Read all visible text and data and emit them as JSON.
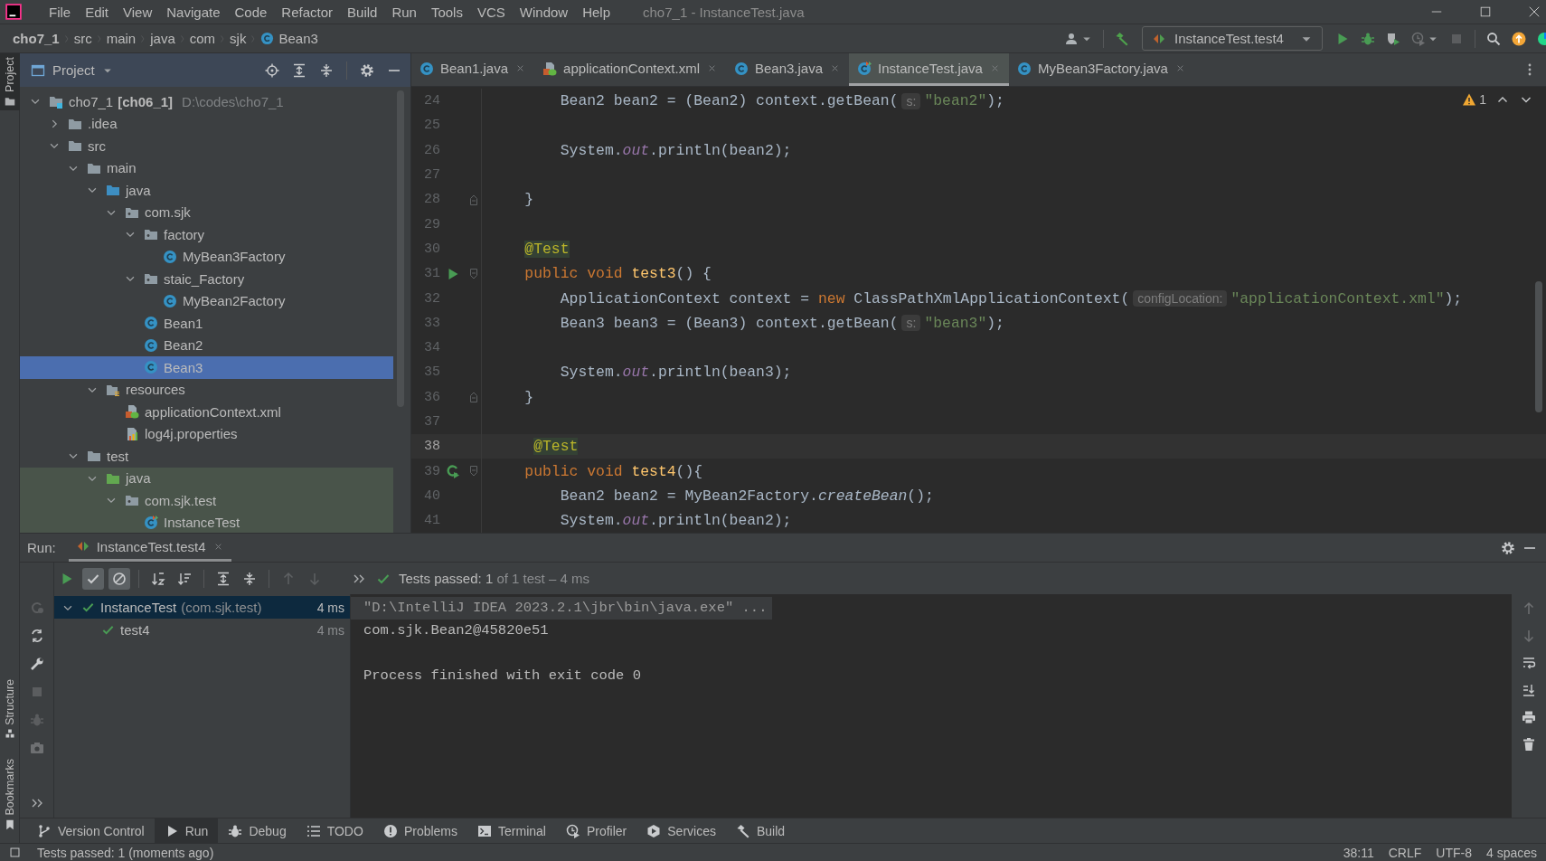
{
  "window": {
    "title": "cho7_1 - InstanceTest.java"
  },
  "menu": [
    "File",
    "Edit",
    "View",
    "Navigate",
    "Code",
    "Refactor",
    "Build",
    "Run",
    "Tools",
    "VCS",
    "Window",
    "Help"
  ],
  "breadcrumbs": [
    {
      "label": "cho7_1",
      "kind": "project"
    },
    {
      "label": "src",
      "kind": "folder"
    },
    {
      "label": "main",
      "kind": "folder"
    },
    {
      "label": "java",
      "kind": "folder"
    },
    {
      "label": "com",
      "kind": "folder"
    },
    {
      "label": "sjk",
      "kind": "folder"
    },
    {
      "label": "Bean3",
      "kind": "class"
    }
  ],
  "run_configuration": "InstanceTest.test4",
  "side_tabs": [
    {
      "label": "Project",
      "selected": true
    },
    {
      "label": "Structure",
      "selected": false
    },
    {
      "label": "Bookmarks",
      "selected": false
    }
  ],
  "project_panel": {
    "title": "Project",
    "tree": [
      {
        "label": "cho7_1",
        "module": "[ch06_1]",
        "path": "D:\\codes\\cho7_1",
        "kind": "module",
        "expanded": true,
        "selected": false,
        "children": [
          {
            "label": ".idea",
            "kind": "folder",
            "expanded": false,
            "selected": false
          },
          {
            "label": "src",
            "kind": "folder",
            "expanded": true,
            "selected": false,
            "children": [
              {
                "label": "main",
                "kind": "folder",
                "expanded": true,
                "selected": false,
                "children": [
                  {
                    "label": "java",
                    "kind": "source_root",
                    "expanded": true,
                    "selected": false,
                    "children": [
                      {
                        "label": "com.sjk",
                        "kind": "package",
                        "expanded": true,
                        "selected": false,
                        "children": [
                          {
                            "label": "factory",
                            "kind": "package",
                            "expanded": true,
                            "selected": false,
                            "children": [
                              {
                                "label": "MyBean3Factory",
                                "kind": "class",
                                "selected": false
                              }
                            ]
                          },
                          {
                            "label": "staic_Factory",
                            "kind": "package",
                            "expanded": true,
                            "selected": false,
                            "children": [
                              {
                                "label": "MyBean2Factory",
                                "kind": "class",
                                "selected": false
                              }
                            ]
                          },
                          {
                            "label": "Bean1",
                            "kind": "class",
                            "selected": false
                          },
                          {
                            "label": "Bean2",
                            "kind": "class",
                            "selected": false
                          },
                          {
                            "label": "Bean3",
                            "kind": "class",
                            "selected": true
                          }
                        ]
                      }
                    ]
                  },
                  {
                    "label": "resources",
                    "kind": "resource_root",
                    "expanded": true,
                    "selected": false,
                    "children": [
                      {
                        "label": "applicationContext.xml",
                        "kind": "xml",
                        "selected": false
                      },
                      {
                        "label": "log4j.properties",
                        "kind": "properties",
                        "selected": false
                      }
                    ]
                  }
                ]
              },
              {
                "label": "test",
                "kind": "folder",
                "expanded": true,
                "selected": false,
                "children": [
                  {
                    "label": "java",
                    "kind": "test_root",
                    "expanded": true,
                    "selected": false,
                    "test_scope": true,
                    "children": [
                      {
                        "label": "com.sjk.test",
                        "kind": "package",
                        "expanded": true,
                        "selected": false,
                        "test_scope": true,
                        "children": [
                          {
                            "label": "InstanceTest",
                            "kind": "test_class",
                            "selected": false,
                            "test_scope": true
                          }
                        ]
                      }
                    ]
                  }
                ]
              }
            ]
          }
        ]
      }
    ]
  },
  "editor_tabs": [
    {
      "label": "Bean1.java",
      "kind": "class",
      "selected": false
    },
    {
      "label": "applicationContext.xml",
      "kind": "xml",
      "selected": false
    },
    {
      "label": "Bean3.java",
      "kind": "class",
      "selected": false
    },
    {
      "label": "InstanceTest.java",
      "kind": "test_class",
      "selected": true
    },
    {
      "label": "MyBean3Factory.java",
      "kind": "class",
      "selected": false
    }
  ],
  "editor": {
    "warning_count": "1",
    "lines": [
      {
        "number": "24",
        "tokens": [
          {
            "text": "        Bean2 bean2 = (Bean2) context.getBean(",
            "kind": "plain"
          },
          {
            "text": "s:",
            "kind": "hint"
          },
          {
            "text": "\"bean2\"",
            "kind": "string"
          },
          {
            "text": ");",
            "kind": "plain"
          }
        ]
      },
      {
        "number": "25"
      },
      {
        "number": "26",
        "tokens": [
          {
            "text": "        System.",
            "kind": "plain"
          },
          {
            "text": "out",
            "kind": "field"
          },
          {
            "text": ".println(bean2);",
            "kind": "plain"
          }
        ]
      },
      {
        "number": "27"
      },
      {
        "number": "28",
        "kind": "block_end",
        "tokens": [
          {
            "text": "    }",
            "kind": "plain"
          }
        ]
      },
      {
        "number": "29"
      },
      {
        "number": "30",
        "tokens": [
          {
            "text": "    @Test",
            "kind": "annotation"
          }
        ]
      },
      {
        "number": "31",
        "kind": "run_method",
        "tokens": [
          {
            "text": "    public void ",
            "kind": "keyword"
          },
          {
            "text": "test3",
            "kind": "method"
          },
          {
            "text": "() {",
            "kind": "plain"
          }
        ]
      },
      {
        "number": "32",
        "tokens": [
          {
            "text": "        ApplicationContext context = ",
            "kind": "plain"
          },
          {
            "text": "new ",
            "kind": "keyword"
          },
          {
            "text": "ClassPathXmlApplicationContext(",
            "kind": "plain"
          },
          {
            "text": "configLocation:",
            "kind": "hint"
          },
          {
            "text": "\"applicationContext.xml\"",
            "kind": "string"
          },
          {
            "text": ");",
            "kind": "plain"
          }
        ]
      },
      {
        "number": "33",
        "tokens": [
          {
            "text": "        Bean3 bean3 = (Bean3) context.getBean(",
            "kind": "plain"
          },
          {
            "text": "s:",
            "kind": "hint"
          },
          {
            "text": "\"bean3\"",
            "kind": "string"
          },
          {
            "text": ");",
            "kind": "plain"
          }
        ]
      },
      {
        "number": "34"
      },
      {
        "number": "35",
        "tokens": [
          {
            "text": "        System.",
            "kind": "plain"
          },
          {
            "text": "out",
            "kind": "field"
          },
          {
            "text": ".println(bean3);",
            "kind": "plain"
          }
        ]
      },
      {
        "number": "36",
        "kind": "block_end",
        "tokens": [
          {
            "text": "    }",
            "kind": "plain"
          }
        ]
      },
      {
        "number": "37"
      },
      {
        "number": "38",
        "current": true,
        "tokens": [
          {
            "text": "     @Test",
            "kind": "annotation"
          }
        ]
      },
      {
        "number": "39",
        "kind": "rerun_method",
        "tokens": [
          {
            "text": "    public void ",
            "kind": "keyword"
          },
          {
            "text": "test4",
            "kind": "method"
          },
          {
            "text": "(){",
            "kind": "plain"
          }
        ]
      },
      {
        "number": "40",
        "tokens": [
          {
            "text": "        Bean2 bean2 = MyBean2Factory.",
            "kind": "plain"
          },
          {
            "text": "createBean",
            "kind": "call"
          },
          {
            "text": "();",
            "kind": "plain"
          }
        ]
      },
      {
        "number": "41",
        "tokens": [
          {
            "text": "        System.",
            "kind": "plain"
          },
          {
            "text": "out",
            "kind": "field"
          },
          {
            "text": ".println(bean2);",
            "kind": "plain"
          }
        ]
      }
    ]
  },
  "run_panel": {
    "label": "Run:",
    "tab": "InstanceTest.test4",
    "show_passed": true,
    "show_ignored": true,
    "status_main": "Tests passed: 1",
    "status_detail": "of 1 test – 4 ms",
    "tests": [
      {
        "name": "InstanceTest",
        "package": "(com.sjk.test)",
        "time": "4 ms",
        "passed": true,
        "expanded": true,
        "selected": true,
        "children": [
          {
            "name": "test4",
            "time": "4 ms",
            "passed": true,
            "selected": false
          }
        ]
      }
    ],
    "console": [
      {
        "text": "\"D:\\IntelliJ IDEA 2023.2.1\\jbr\\bin\\java.exe\" ...",
        "kind": "command"
      },
      {
        "text": "com.sjk.Bean2@45820e51",
        "kind": "output"
      },
      {
        "text": "Process finished with exit code 0",
        "kind": "exit"
      }
    ]
  },
  "tool_windows": [
    {
      "label": "Version Control",
      "selected": false
    },
    {
      "label": "Run",
      "selected": true
    },
    {
      "label": "Debug",
      "selected": false
    },
    {
      "label": "TODO",
      "selected": false
    },
    {
      "label": "Problems",
      "selected": false
    },
    {
      "label": "Terminal",
      "selected": false
    },
    {
      "label": "Profiler",
      "selected": false
    },
    {
      "label": "Services",
      "selected": false
    },
    {
      "label": "Build",
      "selected": false
    }
  ],
  "status_bar": {
    "message": "Tests passed: 1 (moments ago)",
    "items": [
      "38:11",
      "CRLF",
      "UTF-8",
      "4 spaces"
    ]
  }
}
